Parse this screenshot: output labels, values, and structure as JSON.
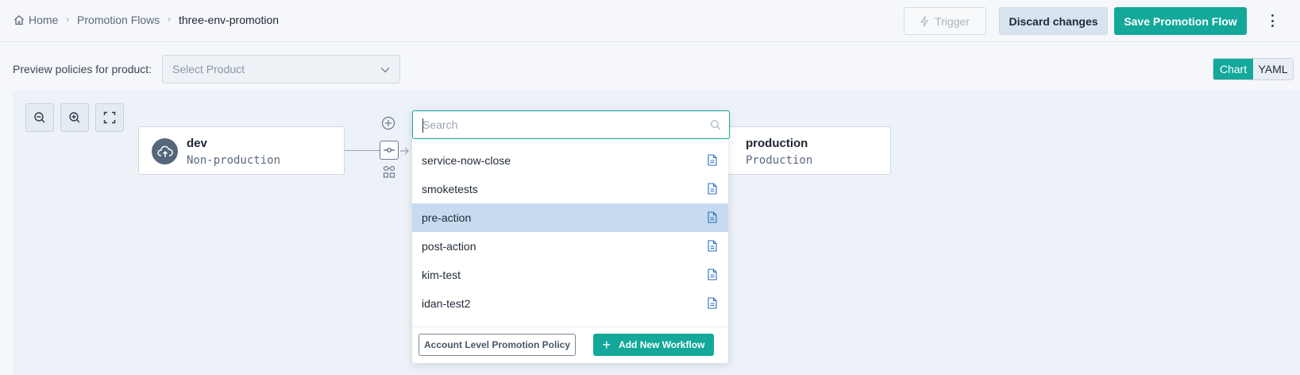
{
  "breadcrumb": {
    "home": "Home",
    "section": "Promotion Flows",
    "current": "three-env-promotion"
  },
  "toolbar": {
    "trigger_label": "Trigger",
    "discard_label": "Discard changes",
    "save_label": "Save Promotion Flow"
  },
  "preview": {
    "label": "Preview policies for product:",
    "select_value": "Select Product"
  },
  "view_toggle": {
    "chart_label": "Chart",
    "yaml_label": "YAML",
    "selected": "Chart"
  },
  "flow": {
    "source_env": {
      "name": "dev",
      "type": "Non-production"
    },
    "target_env": {
      "name": "production",
      "type": "Production"
    }
  },
  "workflow_picker": {
    "search_placeholder": "Search",
    "items": [
      {
        "label": "service-now-close"
      },
      {
        "label": "smoketests"
      },
      {
        "label": "pre-action"
      },
      {
        "label": "post-action"
      },
      {
        "label": "kim-test"
      },
      {
        "label": "idan-test2"
      }
    ],
    "selected_item": "pre-action",
    "policy_button_label": "Account Level Promotion Policy",
    "add_workflow_label": "Add New Workflow"
  },
  "colors": {
    "accent": "#13a89a",
    "highlight": "#c6dbef",
    "env_badge": "#56677b"
  }
}
